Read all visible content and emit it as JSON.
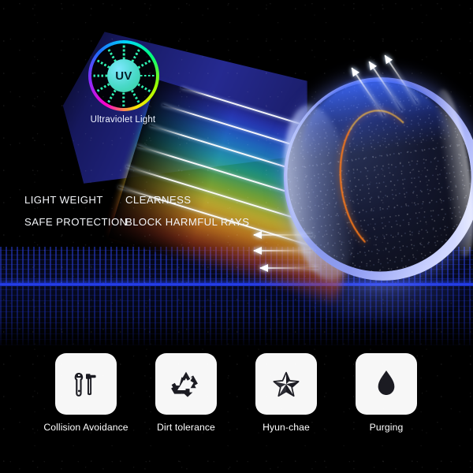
{
  "background": {
    "color": "#000000",
    "horizon_accent": "#2a44f0"
  },
  "uv": {
    "badge_text": "UV",
    "label": "Ultraviolet Light",
    "ring_colors": [
      "#ff00c8",
      "#8a2bff",
      "#1f6bff",
      "#00d6ff",
      "#00ff7a",
      "#9cff00",
      "#ffe600"
    ],
    "sun_color": "#49d9c8"
  },
  "features": [
    {
      "id": "light-weight",
      "text": "LIGHT WEIGHT"
    },
    {
      "id": "clearness",
      "text": "CLEARNESS"
    },
    {
      "id": "safe-protection",
      "text": "SAFE PROTECTION"
    },
    {
      "id": "block-harmful-rays",
      "text": "BLOCK HARMFUL RAYS"
    }
  ],
  "lens": {
    "rim_color": "#9aa6f6",
    "body_color": "#0b0d18",
    "arc_color": "#ff7a18",
    "top_glow_color": "#3c69ff"
  },
  "icons": [
    {
      "id": "collision-avoidance",
      "label": "Collision Avoidance",
      "icon": "wrench-hammer-icon"
    },
    {
      "id": "dirt-tolerance",
      "label": "Dirt tolerance",
      "icon": "recycle-icon"
    },
    {
      "id": "hyun-chae",
      "label": "Hyun-chae",
      "icon": "star-icon"
    },
    {
      "id": "purging",
      "label": "Purging",
      "icon": "water-drop-icon"
    }
  ],
  "icon_card": {
    "background": "#f7f7f7",
    "glyph_color": "#1b1b22"
  }
}
